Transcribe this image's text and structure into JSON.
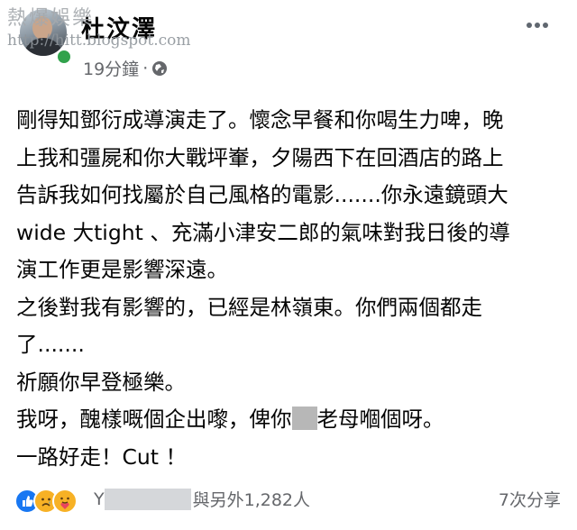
{
  "watermark": {
    "title": "熱爆娛樂",
    "url": "http://hitt.blogspot.com"
  },
  "post": {
    "author": "杜汶澤",
    "time": "19分鐘",
    "separator": "·",
    "privacy_icon": "globe-icon",
    "paragraphs": [
      "剛得知鄧衍成導演走了。懷念早餐和你喝生力啤，晚",
      "上我和彊屍和你大戰坪輋，夕陽西下在回酒店的路上",
      "告訴我如何找屬於自己風格的電影.......你永遠鏡頭大",
      "wide 大tight 、充滿小津安二郎的氣味對我日後的導",
      "演工作更是影響深遠。",
      "之後對我有影響的，已經是林嶺東。你們兩個都走",
      "了.......",
      "祈願你早登極樂。"
    ],
    "line9_before": "我呀，醜樣嘅個企出嚟，俾你",
    "line9_after": "老母嗰個呀。",
    "line10": "一路好走！Cut ！"
  },
  "footer": {
    "reactions": [
      "like-icon",
      "sad-icon",
      "care-icon"
    ],
    "reaction_names_prefix": "Y",
    "reaction_names_suffix": "與另外1,282人",
    "shares": "7次分享"
  },
  "colors": {
    "online": "#31a24c",
    "like": "#1877f2",
    "emoji": "#f7b125",
    "muted": "#65676b"
  }
}
